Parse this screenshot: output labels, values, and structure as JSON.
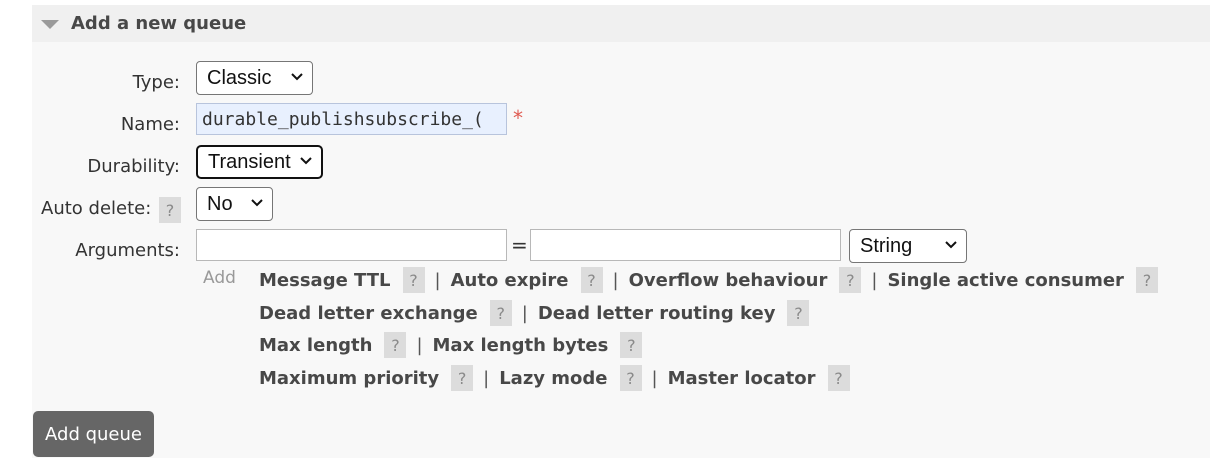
{
  "section": {
    "title": "Add a new queue"
  },
  "form": {
    "type_label": "Type:",
    "type_value": "Classic",
    "name_label": "Name:",
    "name_value": "durable_publishsubscribe_(",
    "required_mark": "*",
    "durability_label": "Durability:",
    "durability_value": "Transient",
    "auto_delete_label": "Auto delete:",
    "auto_delete_help": "?",
    "auto_delete_value": "No",
    "arguments_label": "Arguments:",
    "argument_key": "",
    "equals": "=",
    "argument_value": "",
    "argument_type": "String",
    "add_link": "Add"
  },
  "shortcuts": [
    [
      {
        "label": "Message TTL",
        "help": "?"
      },
      {
        "label": "Auto expire",
        "help": "?"
      },
      {
        "label": "Overflow behaviour",
        "help": "?"
      },
      {
        "label": "Single active consumer",
        "help": "?"
      }
    ],
    [
      {
        "label": "Dead letter exchange",
        "help": "?"
      },
      {
        "label": "Dead letter routing key",
        "help": "?"
      }
    ],
    [
      {
        "label": "Max length",
        "help": "?"
      },
      {
        "label": "Max length bytes",
        "help": "?"
      }
    ],
    [
      {
        "label": "Maximum priority",
        "help": "?"
      },
      {
        "label": "Lazy mode",
        "help": "?"
      },
      {
        "label": "Master locator",
        "help": "?"
      }
    ]
  ],
  "separator": "|",
  "submit": {
    "label": "Add queue"
  }
}
